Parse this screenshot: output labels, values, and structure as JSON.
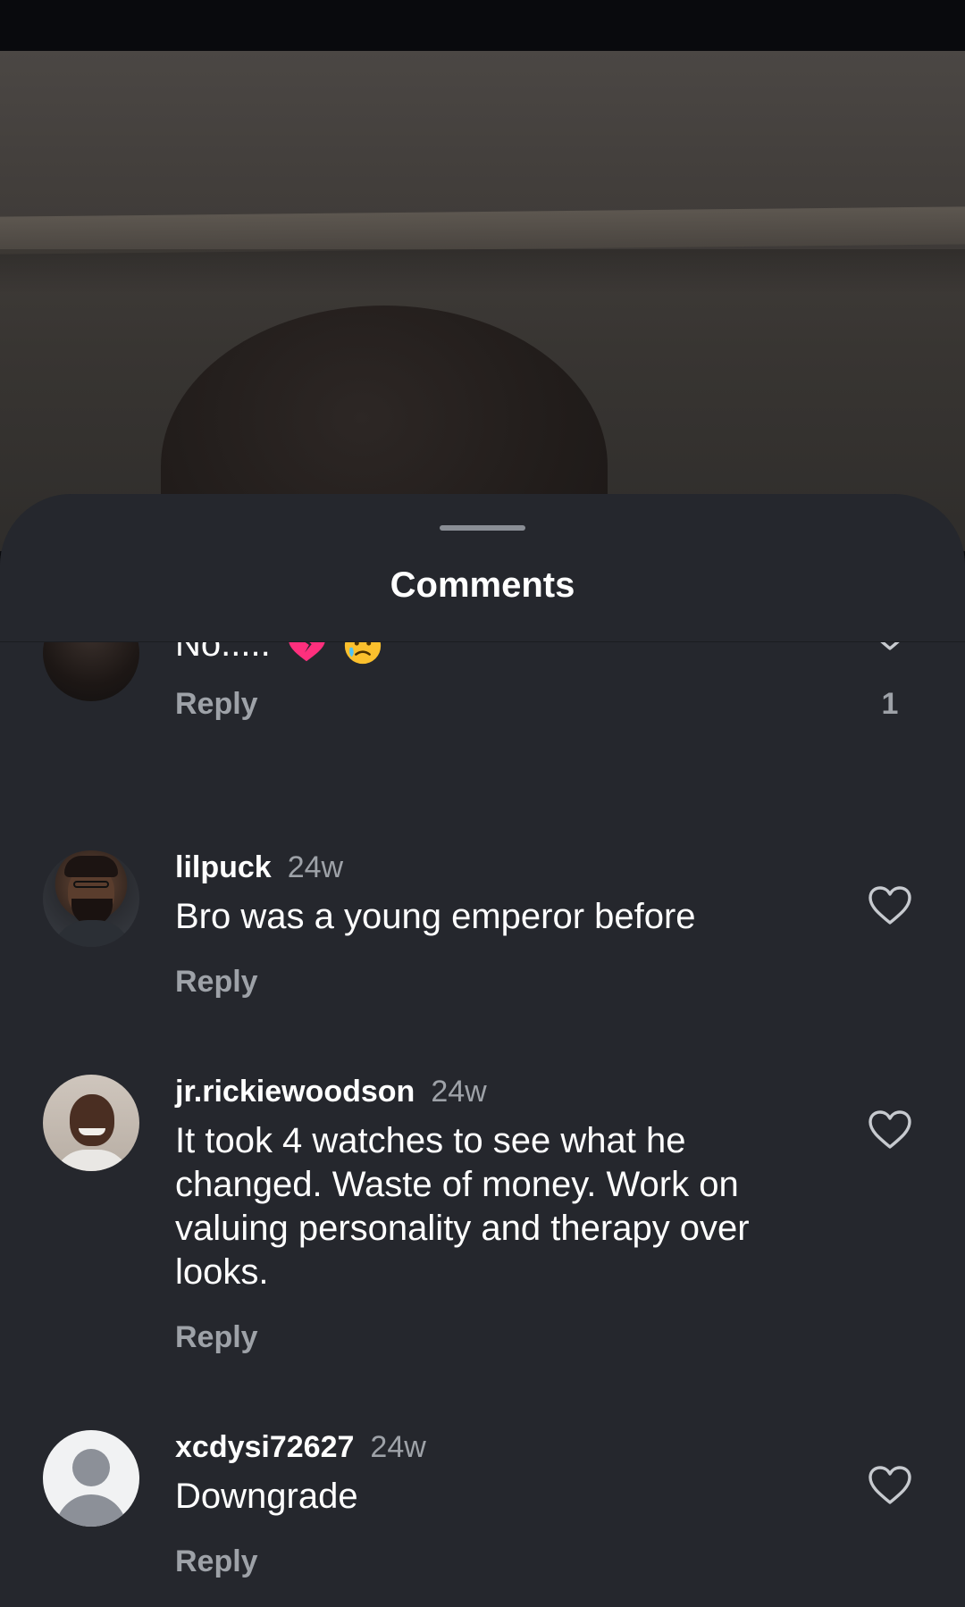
{
  "sheet": {
    "title": "Comments"
  },
  "comments": [
    {
      "user": "",
      "time": "",
      "text": "No.....",
      "emojis": [
        "broken-heart-emoji",
        "crying-face-emoji"
      ],
      "reply_label": "Reply",
      "likes": "1",
      "avatar": "dark-photo-avatar"
    },
    {
      "user": "lilpuck",
      "time": "24w",
      "text": "Bro was a young emperor before",
      "reply_label": "Reply",
      "likes": "",
      "avatar": "photo-avatar"
    },
    {
      "user": "jr.rickiewoodson",
      "time": "24w",
      "text": "It took 4 watches to see what he changed. Waste of money. Work on valuing personality and therapy over looks.",
      "reply_label": "Reply",
      "likes": "",
      "avatar": "photo-avatar"
    },
    {
      "user": "xcdysi72627",
      "time": "24w",
      "text": "Downgrade",
      "reply_label": "Reply",
      "likes": "",
      "avatar": "default-user-avatar"
    }
  ],
  "icons": {
    "like": "heart-outline-icon"
  },
  "colors": {
    "sheet_bg": "#25272d",
    "text_primary": "#ffffff",
    "text_secondary": "#9ea2a8"
  }
}
